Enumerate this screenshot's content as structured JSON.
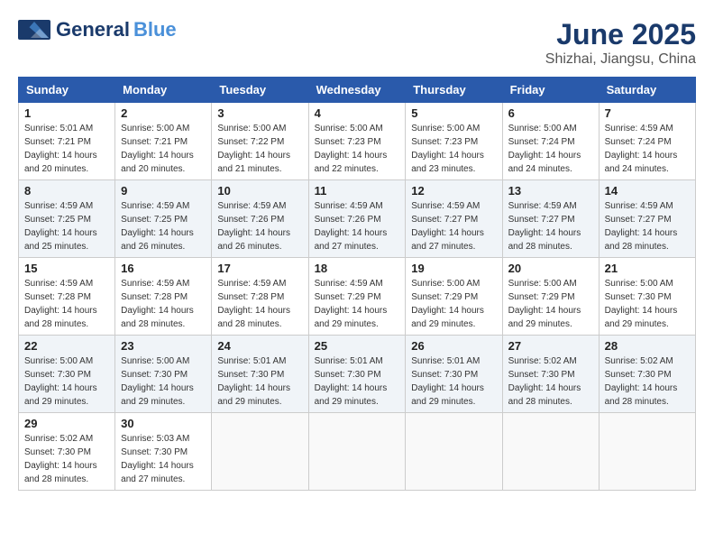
{
  "header": {
    "logo_general": "General",
    "logo_blue": "Blue",
    "month": "June 2025",
    "location": "Shizhai, Jiangsu, China"
  },
  "weekdays": [
    "Sunday",
    "Monday",
    "Tuesday",
    "Wednesday",
    "Thursday",
    "Friday",
    "Saturday"
  ],
  "weeks": [
    [
      {
        "day": "1",
        "sunrise": "5:01 AM",
        "sunset": "7:21 PM",
        "daylight": "14 hours and 20 minutes."
      },
      {
        "day": "2",
        "sunrise": "5:00 AM",
        "sunset": "7:21 PM",
        "daylight": "14 hours and 20 minutes."
      },
      {
        "day": "3",
        "sunrise": "5:00 AM",
        "sunset": "7:22 PM",
        "daylight": "14 hours and 21 minutes."
      },
      {
        "day": "4",
        "sunrise": "5:00 AM",
        "sunset": "7:23 PM",
        "daylight": "14 hours and 22 minutes."
      },
      {
        "day": "5",
        "sunrise": "5:00 AM",
        "sunset": "7:23 PM",
        "daylight": "14 hours and 23 minutes."
      },
      {
        "day": "6",
        "sunrise": "5:00 AM",
        "sunset": "7:24 PM",
        "daylight": "14 hours and 24 minutes."
      },
      {
        "day": "7",
        "sunrise": "4:59 AM",
        "sunset": "7:24 PM",
        "daylight": "14 hours and 24 minutes."
      }
    ],
    [
      {
        "day": "8",
        "sunrise": "4:59 AM",
        "sunset": "7:25 PM",
        "daylight": "14 hours and 25 minutes."
      },
      {
        "day": "9",
        "sunrise": "4:59 AM",
        "sunset": "7:25 PM",
        "daylight": "14 hours and 26 minutes."
      },
      {
        "day": "10",
        "sunrise": "4:59 AM",
        "sunset": "7:26 PM",
        "daylight": "14 hours and 26 minutes."
      },
      {
        "day": "11",
        "sunrise": "4:59 AM",
        "sunset": "7:26 PM",
        "daylight": "14 hours and 27 minutes."
      },
      {
        "day": "12",
        "sunrise": "4:59 AM",
        "sunset": "7:27 PM",
        "daylight": "14 hours and 27 minutes."
      },
      {
        "day": "13",
        "sunrise": "4:59 AM",
        "sunset": "7:27 PM",
        "daylight": "14 hours and 28 minutes."
      },
      {
        "day": "14",
        "sunrise": "4:59 AM",
        "sunset": "7:27 PM",
        "daylight": "14 hours and 28 minutes."
      }
    ],
    [
      {
        "day": "15",
        "sunrise": "4:59 AM",
        "sunset": "7:28 PM",
        "daylight": "14 hours and 28 minutes."
      },
      {
        "day": "16",
        "sunrise": "4:59 AM",
        "sunset": "7:28 PM",
        "daylight": "14 hours and 28 minutes."
      },
      {
        "day": "17",
        "sunrise": "4:59 AM",
        "sunset": "7:28 PM",
        "daylight": "14 hours and 28 minutes."
      },
      {
        "day": "18",
        "sunrise": "4:59 AM",
        "sunset": "7:29 PM",
        "daylight": "14 hours and 29 minutes."
      },
      {
        "day": "19",
        "sunrise": "5:00 AM",
        "sunset": "7:29 PM",
        "daylight": "14 hours and 29 minutes."
      },
      {
        "day": "20",
        "sunrise": "5:00 AM",
        "sunset": "7:29 PM",
        "daylight": "14 hours and 29 minutes."
      },
      {
        "day": "21",
        "sunrise": "5:00 AM",
        "sunset": "7:30 PM",
        "daylight": "14 hours and 29 minutes."
      }
    ],
    [
      {
        "day": "22",
        "sunrise": "5:00 AM",
        "sunset": "7:30 PM",
        "daylight": "14 hours and 29 minutes."
      },
      {
        "day": "23",
        "sunrise": "5:00 AM",
        "sunset": "7:30 PM",
        "daylight": "14 hours and 29 minutes."
      },
      {
        "day": "24",
        "sunrise": "5:01 AM",
        "sunset": "7:30 PM",
        "daylight": "14 hours and 29 minutes."
      },
      {
        "day": "25",
        "sunrise": "5:01 AM",
        "sunset": "7:30 PM",
        "daylight": "14 hours and 29 minutes."
      },
      {
        "day": "26",
        "sunrise": "5:01 AM",
        "sunset": "7:30 PM",
        "daylight": "14 hours and 29 minutes."
      },
      {
        "day": "27",
        "sunrise": "5:02 AM",
        "sunset": "7:30 PM",
        "daylight": "14 hours and 28 minutes."
      },
      {
        "day": "28",
        "sunrise": "5:02 AM",
        "sunset": "7:30 PM",
        "daylight": "14 hours and 28 minutes."
      }
    ],
    [
      {
        "day": "29",
        "sunrise": "5:02 AM",
        "sunset": "7:30 PM",
        "daylight": "14 hours and 28 minutes."
      },
      {
        "day": "30",
        "sunrise": "5:03 AM",
        "sunset": "7:30 PM",
        "daylight": "14 hours and 27 minutes."
      },
      null,
      null,
      null,
      null,
      null
    ]
  ],
  "labels": {
    "sunrise": "Sunrise:",
    "sunset": "Sunset:",
    "daylight": "Daylight:"
  }
}
